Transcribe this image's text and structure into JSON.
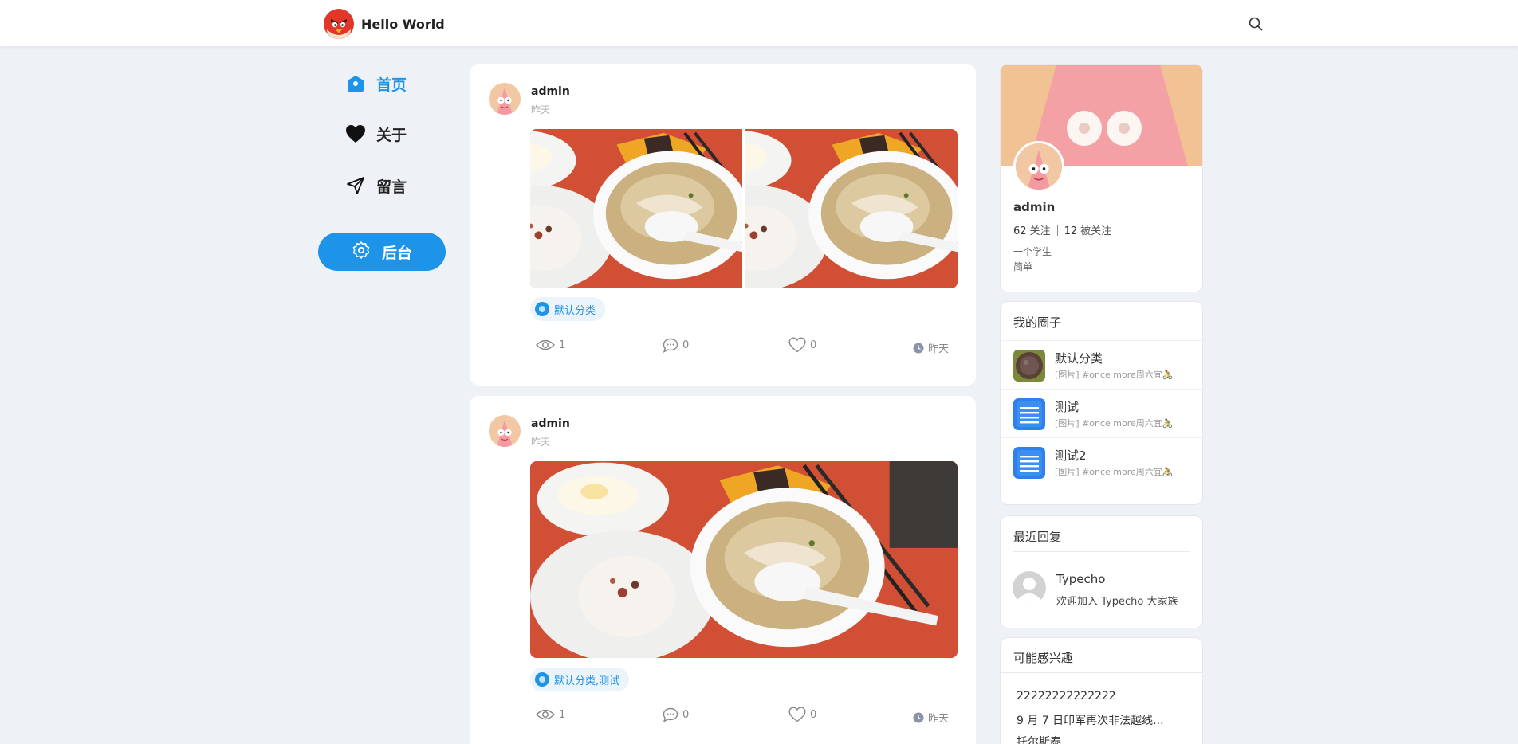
{
  "header": {
    "site_name": "Hello World",
    "logo_icon": "angry-bird-logo",
    "search_icon": "search-icon"
  },
  "nav": {
    "items": [
      {
        "label": "首页",
        "icon": "home-icon",
        "active": true
      },
      {
        "label": "关于",
        "icon": "heart-icon",
        "active": false
      },
      {
        "label": "留言",
        "icon": "send-icon",
        "active": false
      }
    ],
    "admin_button": {
      "label": "后台",
      "icon": "gear-icon"
    }
  },
  "posts": [
    {
      "author": "admin",
      "time": "昨天",
      "images": [
        "food-photo",
        "food-photo"
      ],
      "tag": "默认分类",
      "stats": {
        "views": "1",
        "comments": "0",
        "likes": "0",
        "time": "昨天"
      }
    },
    {
      "author": "admin",
      "time": "昨天",
      "images": [
        "food-photo"
      ],
      "tag": "默认分类,测试",
      "stats": {
        "views": "1",
        "comments": "0",
        "likes": "0",
        "time": "昨天"
      }
    }
  ],
  "profile": {
    "name": "admin",
    "following_count": "62",
    "following_label": "关注",
    "followers_count": "12",
    "followers_label": "被关注",
    "bio_line1": "一个学生",
    "bio_line2": "简单"
  },
  "circles": {
    "title": "我的圈子",
    "items": [
      {
        "name": "默认分类",
        "desc": "[图片] #once more周六宜🚴"
      },
      {
        "name": "测试",
        "desc": "[图片] #once more周六宜🚴"
      },
      {
        "name": "测试2",
        "desc": "[图片] #once more周六宜🚴"
      }
    ]
  },
  "recent_replies": {
    "title": "最近回复",
    "items": [
      {
        "name": "Typecho",
        "text": "欢迎加入 Typecho 大家族"
      }
    ]
  },
  "interests": {
    "title": "可能感兴趣",
    "items": [
      "22222222222222",
      "9 月 7 日印军再次非法越线...",
      "托尔斯泰"
    ]
  },
  "colors": {
    "accent": "#1e94e8",
    "page_background": "#eef2f6"
  }
}
